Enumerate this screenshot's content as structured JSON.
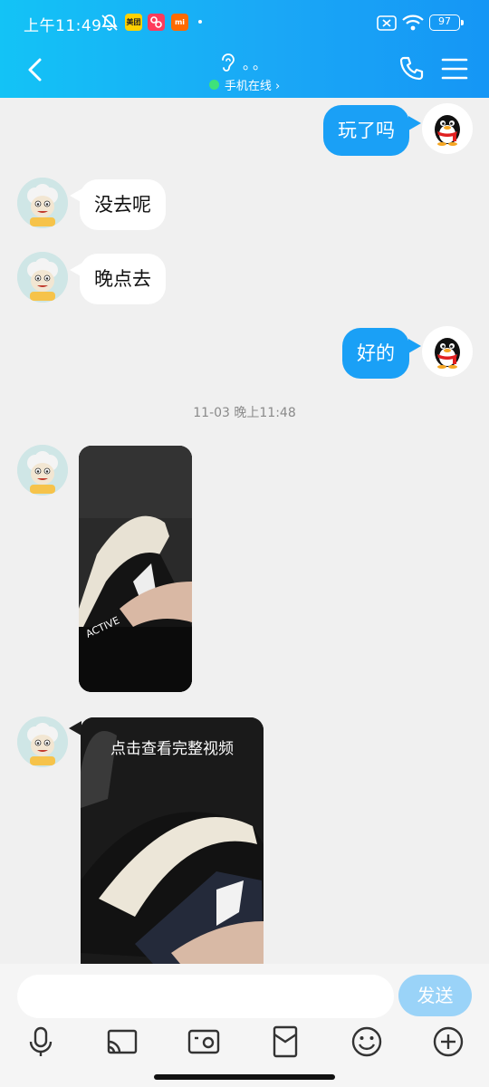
{
  "status_bar": {
    "time": "上午11:49",
    "app_icons": [
      "美团",
      "小红书",
      "mi"
    ],
    "battery": "97"
  },
  "header": {
    "title": "。。",
    "subtitle": "手机在线 ›",
    "online_color": "#3ee27b",
    "accent": "#1aa0f6"
  },
  "messages": [
    {
      "from": "me",
      "text": "玩了吗"
    },
    {
      "from": "friend",
      "text": "没去呢"
    },
    {
      "from": "friend",
      "text": "晚点去"
    },
    {
      "from": "me",
      "text": "好的"
    }
  ],
  "timestamp": "11-03 晚上11:48",
  "media": {
    "image_shoe_text": "ACTIVE",
    "video_caption": "点击查看完整视频"
  },
  "input": {
    "placeholder": "",
    "send_label": "发送"
  },
  "toolbar_icons": [
    "mic-icon",
    "cast-icon",
    "photo-icon",
    "red-packet-icon",
    "emoji-icon",
    "plus-icon"
  ]
}
